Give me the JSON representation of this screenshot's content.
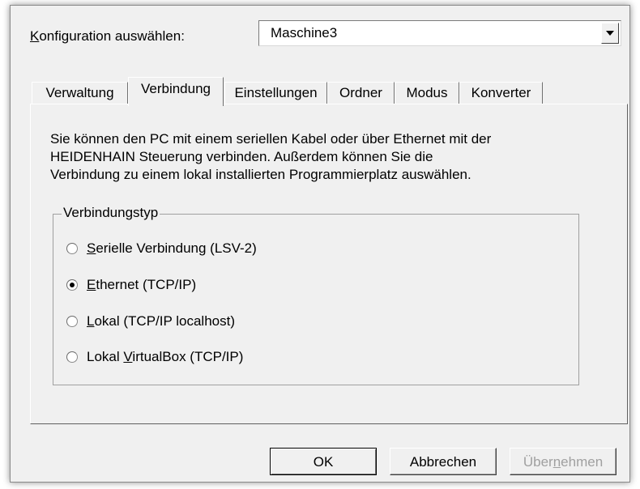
{
  "config": {
    "label_mnemonic": "K",
    "label_rest": "onfiguration auswählen:",
    "selected": "Maschine3"
  },
  "tabs": [
    {
      "label": "Verwaltung",
      "active": false
    },
    {
      "label": "Verbindung",
      "active": true
    },
    {
      "label": "Einstellungen",
      "active": false
    },
    {
      "label": "Ordner",
      "active": false
    },
    {
      "label": "Modus",
      "active": false
    },
    {
      "label": "Konverter",
      "active": false
    }
  ],
  "panel": {
    "description": [
      "Sie können den PC mit einem seriellen Kabel oder über Ethernet mit der",
      "HEIDENHAIN Steuerung verbinden. Außerdem können Sie die",
      "Verbindung zu einem lokal installierten Programmierplatz auswählen."
    ],
    "group_title": "Verbindungstyp",
    "options": [
      {
        "pre": "",
        "mnemonic": "S",
        "post": "erielle Verbindung (LSV-2)",
        "checked": false
      },
      {
        "pre": "",
        "mnemonic": "E",
        "post": "thernet (TCP/IP)",
        "checked": true
      },
      {
        "pre": "",
        "mnemonic": "L",
        "post": "okal (TCP/IP localhost)",
        "checked": false
      },
      {
        "pre": "Lokal ",
        "mnemonic": "V",
        "post": "irtualBox (TCP/IP)",
        "checked": false
      }
    ]
  },
  "buttons": {
    "ok": "OK",
    "cancel": "Abbrechen",
    "apply_pre": "Über",
    "apply_mnemonic": "n",
    "apply_post": "ehmen"
  },
  "icons": {
    "combo_arrow": "chevron-down-icon",
    "radio": "radio-icon"
  }
}
